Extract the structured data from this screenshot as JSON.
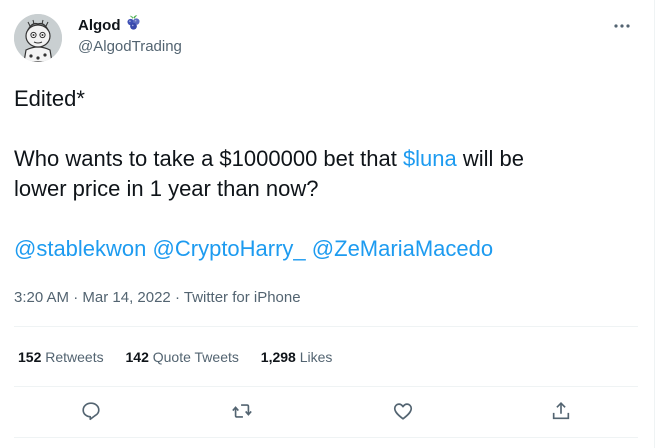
{
  "author": {
    "display_name": "Algod",
    "handle": "@AlgodTrading",
    "badge_icon": "blueberries-icon"
  },
  "tweet": {
    "line1": "Edited*",
    "line2_prefix": "Who wants to take a $1000000 bet that ",
    "cashtag": "$luna",
    "line2_suffix": " will be",
    "line3": "lower price in 1 year than now?",
    "mentions": [
      "@stablekwon",
      "@CryptoHarry_",
      "@ZeMariaMacedo"
    ]
  },
  "meta": {
    "time": "3:20 AM",
    "separator": "·",
    "date": "Mar 14, 2022",
    "source": "Twitter for iPhone"
  },
  "stats": [
    {
      "count": "152",
      "label": "Retweets"
    },
    {
      "count": "142",
      "label": "Quote Tweets"
    },
    {
      "count": "1,298",
      "label": "Likes"
    }
  ],
  "actions": [
    "reply-icon",
    "retweet-icon",
    "like-icon",
    "share-icon"
  ],
  "colors": {
    "link": "#1d9bf0",
    "text": "#0f1419",
    "secondary": "#536471",
    "divider": "#eff3f4"
  }
}
